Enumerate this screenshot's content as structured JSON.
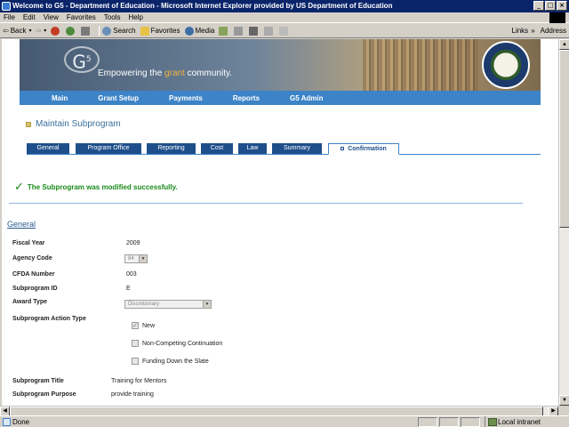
{
  "window": {
    "title": "Welcome to G5 - Department of Education - Microsoft Internet Explorer provided by US Department of Education"
  },
  "menu": [
    "File",
    "Edit",
    "View",
    "Favorites",
    "Tools",
    "Help"
  ],
  "toolbar": {
    "back": "Back",
    "search": "Search",
    "favorites": "Favorites",
    "media": "Media",
    "links": "Links",
    "address": "Address"
  },
  "banner": {
    "logo_text": "G",
    "logo_sup": "5",
    "tagline_pre": "Empowering the ",
    "tagline_highlight": "grant",
    "tagline_post": " community."
  },
  "nav": [
    "Main",
    "Grant Setup",
    "Payments",
    "Reports",
    "G5 Admin"
  ],
  "page_title": "Maintain Subprogram",
  "tabs": [
    "General",
    "Program Office",
    "Reporting",
    "Cost",
    "Law",
    "Summary",
    "Confirmation"
  ],
  "active_tab": "Confirmation",
  "success_message": "The Subprogram was modified successfully.",
  "general_link": "General",
  "fields": {
    "fiscal_year": {
      "label": "Fiscal Year",
      "value": "2009"
    },
    "agency_code": {
      "label": "Agency Code",
      "value": "84"
    },
    "cfda_number": {
      "label": "CFDA Number",
      "value": "003"
    },
    "subprogram_id": {
      "label": "Subprogram ID",
      "value": "E"
    },
    "award_type": {
      "label": "Award Type",
      "value": "Discretionary"
    },
    "action_type": {
      "label": "Subprogram Action Type"
    },
    "title": {
      "label": "Subprogram Title",
      "value": "Training for Mentors"
    },
    "purpose": {
      "label": "Subprogram Purpose",
      "value": "provide training"
    }
  },
  "action_options": [
    {
      "label": "New",
      "checked": true
    },
    {
      "label": "Non-Competing Continuation",
      "checked": false
    },
    {
      "label": "Funding Down the Slate",
      "checked": false
    }
  ],
  "status": {
    "left": "Done",
    "zone": "Local intranet"
  },
  "colors": {
    "nav_blue": "#3c83c7",
    "tab_blue": "#1f4f8b",
    "success_green": "#1a8a1a"
  }
}
